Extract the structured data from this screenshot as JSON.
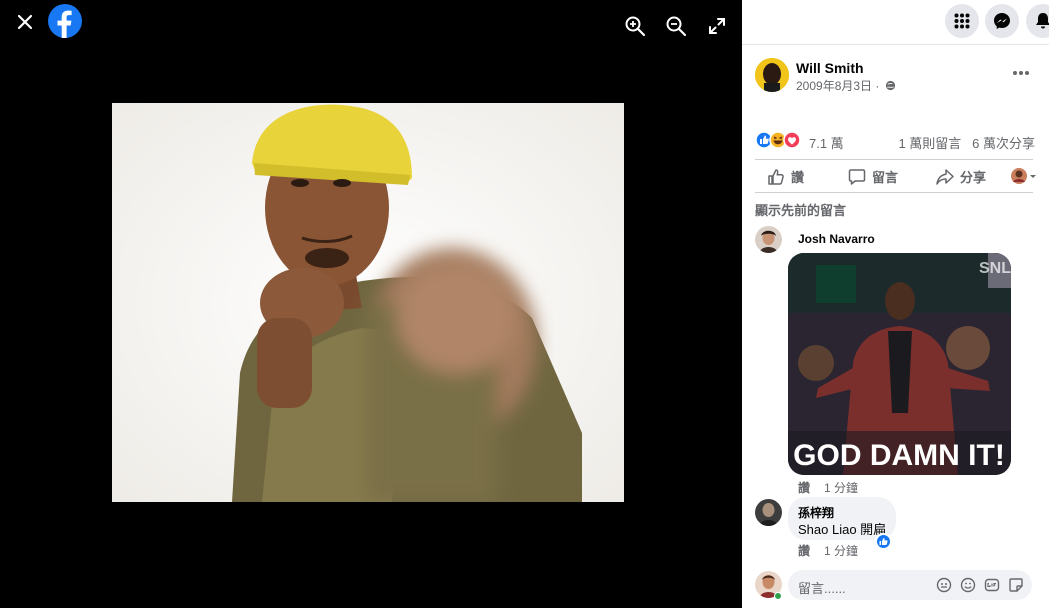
{
  "viewer": {
    "photo_alt": "Will Smith photo"
  },
  "post": {
    "author": "Will Smith",
    "date": "2009年8月3日 ·",
    "reaction_count": "7.1 萬",
    "comments_count": "1 萬則留言",
    "shares_count": "6 萬次分享"
  },
  "actions": {
    "like": "讚",
    "comment": "留言",
    "share": "分享"
  },
  "comments": {
    "show_previous": "顯示先前的留言",
    "items": [
      {
        "name": "Josh Navarro",
        "gif_caption": "GOD DAMN IT!",
        "gif_badge": "SNL",
        "like_label": "讚",
        "time": "1 分鐘"
      },
      {
        "name": "孫梓翔",
        "text": "Shao Liao 開扁",
        "like_label": "讚",
        "time": "1 分鐘"
      }
    ]
  },
  "compose": {
    "placeholder": "留言......"
  },
  "colors": {
    "accent": "#1877f2",
    "hat_yellow": "#e8d33a",
    "jacket_olive": "#7c7142"
  }
}
